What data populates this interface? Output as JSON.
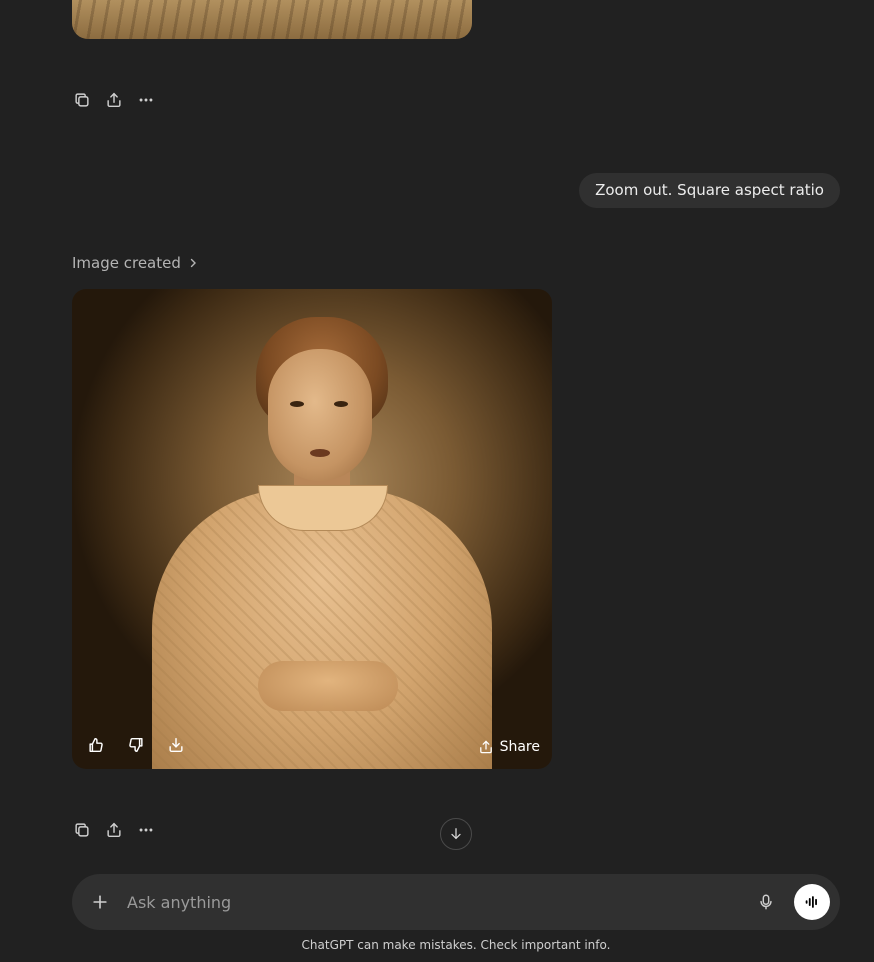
{
  "previous_message": {
    "actions": [
      {
        "name": "copy-icon"
      },
      {
        "name": "share-icon"
      },
      {
        "name": "more-icon"
      }
    ]
  },
  "user_message": {
    "text": "Zoom out. Square aspect ratio"
  },
  "assistant_message": {
    "image_created_label": "Image created",
    "image_share_label": "Share",
    "image_actions": [
      "thumbs-up-icon",
      "thumbs-down-icon",
      "download-icon"
    ]
  },
  "composer": {
    "placeholder": "Ask anything"
  },
  "disclaimer": "ChatGPT can make mistakes. Check important info.",
  "colors": {
    "background": "#212121",
    "bubble": "#303030",
    "composer": "#303030",
    "text": "#ececec",
    "muted": "#b4b4b4"
  }
}
